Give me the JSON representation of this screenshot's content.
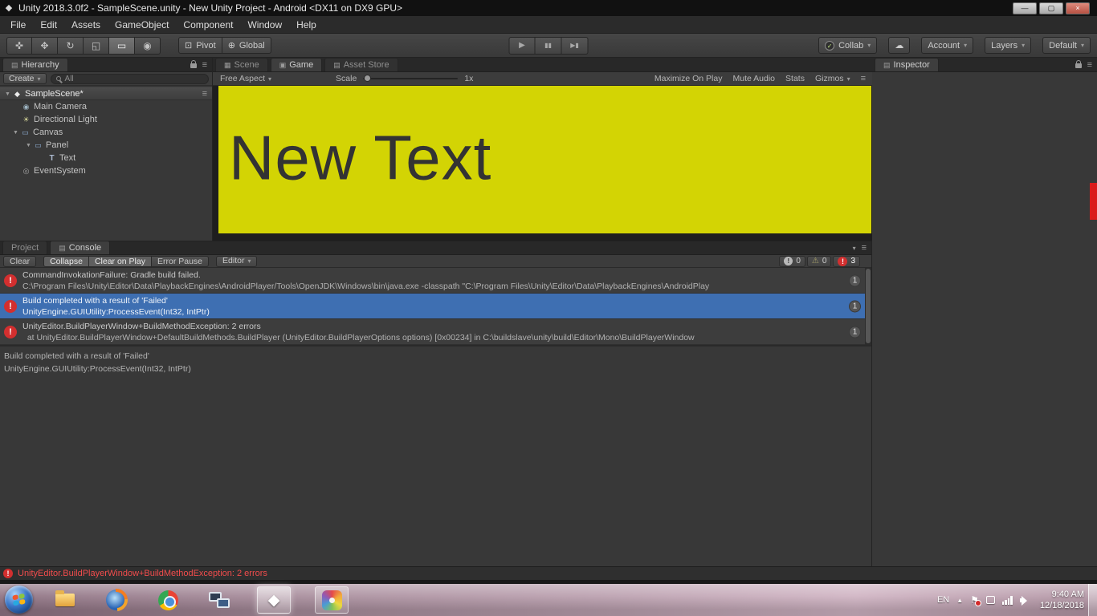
{
  "colors": {
    "game_view_yellow": "#d3d404",
    "selected_row_blue": "#3e6fb2",
    "error_red": "#d32f2f",
    "status_error_text": "#f14c4c",
    "taskbar_tint": "#b295a4"
  },
  "window": {
    "title": "Unity 2018.3.0f2 - SampleScene.unity - New Unity Project - Android <DX11 on DX9 GPU>",
    "buttons": {
      "minimize": "—",
      "maximize": "▢",
      "close": "×"
    }
  },
  "menu_bar": {
    "items": [
      "File",
      "Edit",
      "Assets",
      "GameObject",
      "Component",
      "Window",
      "Help"
    ]
  },
  "toolbar": {
    "pivot_label": "Pivot",
    "global_label": "Global",
    "collab_label": "Collab",
    "account_label": "Account",
    "layers_label": "Layers",
    "layout_label": "Default"
  },
  "icons": {
    "caret_down": "▾",
    "menu": "≡",
    "unity_logo": "◆",
    "hand_tool": "✜",
    "move_tool": "✥",
    "rotate_tool": "↻",
    "scale_tool": "◱",
    "rect_tool": "▭",
    "transform_tool": "◉",
    "pivot": "⊡",
    "global": "⊕",
    "play": "▶",
    "pause": "▮▮",
    "step": "▶▮",
    "check": "✓",
    "cloud": "☁",
    "scene_tab": "▦",
    "game_tab": "▣",
    "asset_tab": "▤",
    "panel_tab": "▤",
    "twisty_open": "▼",
    "unity_scene": "◆",
    "camera": "◉",
    "light": "☀",
    "ui_rect": "▭",
    "text_obj": "T",
    "event_system": "◎",
    "warning": "⚠",
    "error_mark": "!",
    "info_mark": "!",
    "flag": "⚑",
    "chevron_up": "▲"
  },
  "hierarchy": {
    "tab_label": "Hierarchy",
    "create_label": "Create",
    "search_text": "All",
    "scene_name": "SampleScene*",
    "items": [
      {
        "label": "Main Camera"
      },
      {
        "label": "Directional Light"
      },
      {
        "label": "Canvas"
      },
      {
        "label": "Panel"
      },
      {
        "label": "Text"
      },
      {
        "label": "EventSystem"
      }
    ]
  },
  "viewport": {
    "tabs": {
      "scene": "Scene",
      "game": "Game",
      "asset_store": "Asset Store"
    },
    "game_toolbar": {
      "aspect": "Free Aspect",
      "scale_label": "Scale",
      "scale_value": "1x",
      "maximize_on_play": "Maximize On Play",
      "mute_audio": "Mute Audio",
      "stats": "Stats",
      "gizmos": "Gizmos"
    },
    "game_text": "New Text"
  },
  "console": {
    "project_tab": "Project",
    "console_tab": "Console",
    "toolbar": {
      "clear": "Clear",
      "collapse": "Collapse",
      "clear_on_play": "Clear on Play",
      "error_pause": "Error Pause",
      "editor": "Editor",
      "info_count": "0",
      "warning_count": "0",
      "error_count": "3"
    },
    "entries": [
      {
        "line1": "CommandInvokationFailure: Gradle build failed.",
        "line2": "C:\\Program Files\\Unity\\Editor\\Data\\PlaybackEngines\\AndroidPlayer/Tools\\OpenJDK\\Windows\\bin\\java.exe -classpath \"C:\\Program Files\\Unity\\Editor\\Data\\PlaybackEngines\\AndroidPlay",
        "badge": "1"
      },
      {
        "line1": "Build completed with a result of 'Failed'",
        "line2": "UnityEngine.GUIUtility:ProcessEvent(Int32, IntPtr)",
        "badge": "1"
      },
      {
        "line1": "UnityEditor.BuildPlayerWindow+BuildMethodException: 2 errors",
        "line2": "  at UnityEditor.BuildPlayerWindow+DefaultBuildMethods.BuildPlayer (UnityEditor.BuildPlayerOptions options) [0x00234] in C:\\buildslave\\unity\\build\\Editor\\Mono\\BuildPlayerWindow",
        "badge": "1"
      }
    ],
    "detail_line1": "Build completed with a result of 'Failed'",
    "detail_line2": "UnityEngine.GUIUtility:ProcessEvent(Int32, IntPtr)"
  },
  "inspector": {
    "tab_label": "Inspector"
  },
  "status_bar": {
    "text": "UnityEditor.BuildPlayerWindow+BuildMethodException: 2 errors"
  },
  "taskbar": {
    "language": "EN",
    "time": "9:40 AM",
    "date": "12/18/2018"
  }
}
